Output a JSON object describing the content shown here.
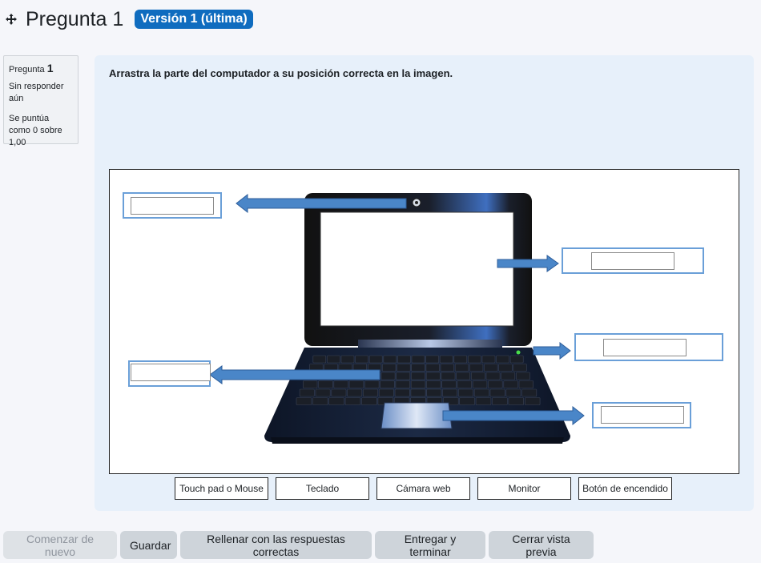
{
  "header": {
    "title": "Pregunta 1",
    "version_badge": "Versión 1 (última)"
  },
  "info": {
    "question_label": "Pregunta",
    "question_number": "1",
    "status": "Sin responder aún",
    "grade": "Se puntúa como 0 sobre 1,00"
  },
  "question": {
    "prompt": "Arrastra la parte del computador a su posición correcta en la imagen."
  },
  "drag_items": [
    "Touch pad o Mouse",
    "Teclado",
    "Cámara web",
    "Monitor",
    "Botón de encendido"
  ],
  "buttons": {
    "start_again": "Comenzar de nuevo",
    "save": "Guardar",
    "fill_correct": "Rellenar con las respuestas correctas",
    "submit": "Entregar y terminar",
    "close_preview": "Cerrar vista previa"
  },
  "colors": {
    "accent": "#0f6cbf",
    "arrow": "#4a86c8",
    "drop_border": "#6a9fd8"
  }
}
